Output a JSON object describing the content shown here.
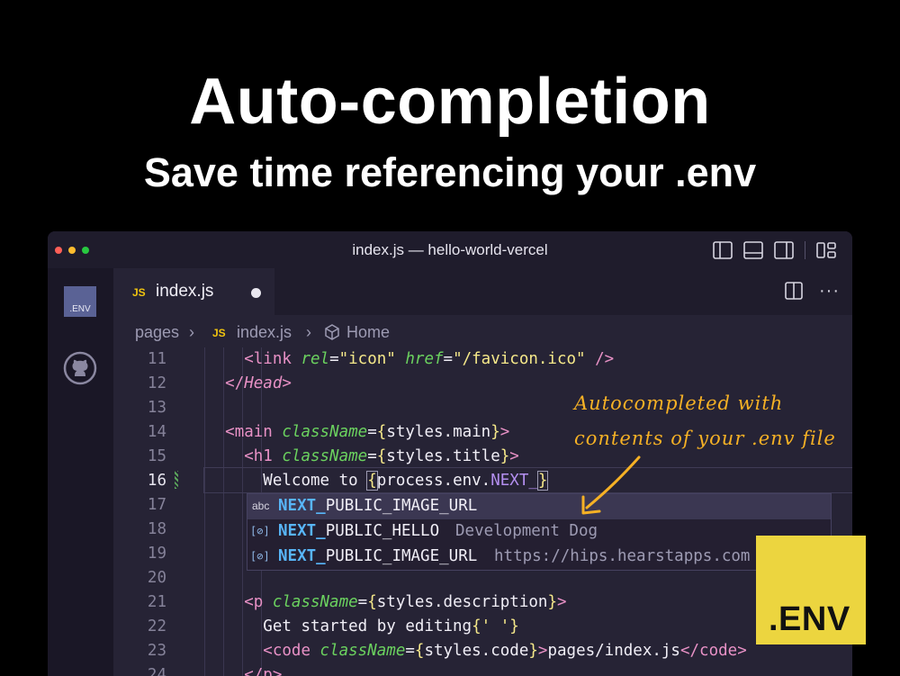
{
  "hero": {
    "title": "Auto-completion",
    "subtitle": "Save time referencing your .env"
  },
  "window": {
    "title": "index.js — hello-world-vercel",
    "traffic_lights": [
      "close",
      "minimize",
      "zoom"
    ]
  },
  "activity_bar": {
    "env_badge": ".ENV",
    "github_icon": "github-icon"
  },
  "tab": {
    "file_type": "JS",
    "label": "index.js",
    "modified": true
  },
  "breadcrumb": {
    "folder": "pages",
    "file_type": "JS",
    "file": "index.js",
    "symbol": "Home"
  },
  "editor": {
    "active_line": 16,
    "lines": [
      {
        "n": "11"
      },
      {
        "n": "12"
      },
      {
        "n": "13"
      },
      {
        "n": "14"
      },
      {
        "n": "15"
      },
      {
        "n": "16"
      },
      {
        "n": "17"
      },
      {
        "n": "18"
      },
      {
        "n": "19"
      },
      {
        "n": "20"
      },
      {
        "n": "21"
      },
      {
        "n": "22"
      },
      {
        "n": "23"
      },
      {
        "n": "24"
      }
    ]
  },
  "suggestions": [
    {
      "kind": "abc",
      "match": "NEXT_",
      "rest": "PUBLIC_IMAGE_URL",
      "detail": ""
    },
    {
      "kind": "[⊘]",
      "match": "NEXT_",
      "rest": "PUBLIC_HELLO",
      "detail": "Development Dog"
    },
    {
      "kind": "[⊘]",
      "match": "NEXT_",
      "rest": "PUBLIC_IMAGE_URL",
      "detail": "https://hips.hearstapps.com"
    }
  ],
  "annotation": {
    "line1": "Autocompleted with",
    "line2": "contents of your .env file"
  },
  "logo": {
    "text": ".ENV"
  },
  "colors": {
    "editor_bg": "#262335",
    "logo_bg": "#ecd53f",
    "annotation": "#f6b125",
    "match": "#58b5f7"
  }
}
